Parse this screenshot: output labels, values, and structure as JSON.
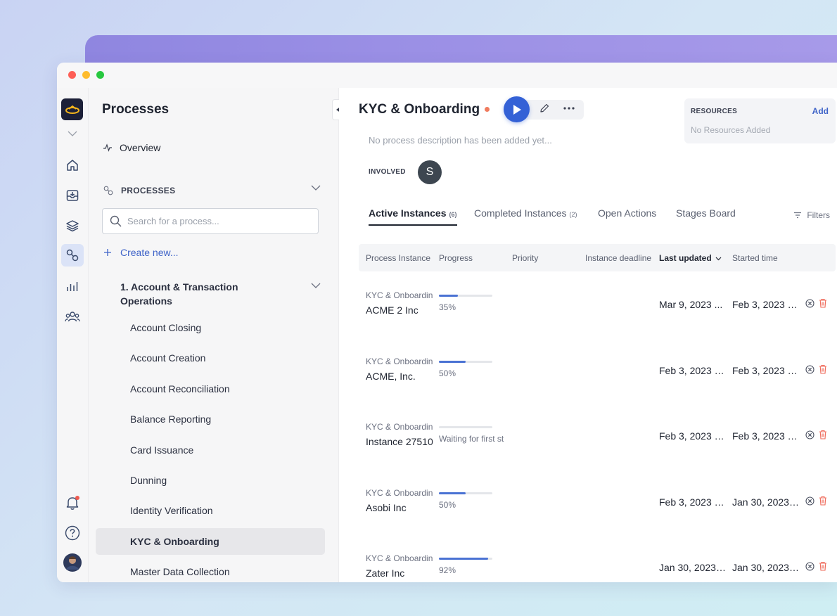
{
  "sidebar": {
    "title": "Processes",
    "overview_label": "Overview",
    "section_label": "PROCESSES",
    "search_placeholder": "Search for a process...",
    "create_label": "Create new...",
    "group_label": "1. Account & Transaction Operations",
    "items": [
      {
        "label": "Account Closing",
        "active": false
      },
      {
        "label": "Account Creation",
        "active": false
      },
      {
        "label": "Account Reconciliation",
        "active": false
      },
      {
        "label": "Balance Reporting",
        "active": false
      },
      {
        "label": "Card Issuance",
        "active": false
      },
      {
        "label": "Dunning",
        "active": false
      },
      {
        "label": "Identity Verification",
        "active": false
      },
      {
        "label": "KYC & Onboarding",
        "active": true
      },
      {
        "label": "Master Data Collection",
        "active": false
      }
    ]
  },
  "rail": {
    "icons": [
      "home-icon",
      "inbox-icon",
      "layers-icon",
      "processes-icon",
      "analytics-icon",
      "team-icon",
      "bell-icon",
      "help-icon",
      "user-avatar"
    ],
    "active": "processes-icon"
  },
  "header": {
    "title": "KYC & Onboarding",
    "description": "No process description has been added yet...",
    "involved_label": "INVOLVED",
    "involved_initial": "S"
  },
  "resources": {
    "label": "RESOURCES",
    "add_label": "Add",
    "empty_text": "No Resources Added"
  },
  "tabs": [
    {
      "label": "Active Instances",
      "count": "(6)",
      "active": true
    },
    {
      "label": "Completed Instances",
      "count": "(2)",
      "active": false
    },
    {
      "label": "Open Actions",
      "count": "",
      "active": false
    },
    {
      "label": "Stages Board",
      "count": "",
      "active": false
    }
  ],
  "filters_label": "Filters",
  "table": {
    "columns": [
      "Process Instance",
      "Progress",
      "Priority",
      "Instance deadline",
      "Last updated",
      "Started time"
    ],
    "sorted_column": "Last updated",
    "rows": [
      {
        "process": "KYC & Onboardin",
        "name": "ACME 2 Inc",
        "progress": 0.35,
        "progress_label": "35%",
        "last_updated": "Mar 9, 2023 ...",
        "started": "Feb 3, 2023 2..."
      },
      {
        "process": "KYC & Onboardin",
        "name": "ACME, Inc.",
        "progress": 0.5,
        "progress_label": "50%",
        "last_updated": "Feb 3, 2023 1...",
        "started": "Feb 3, 2023 1..."
      },
      {
        "process": "KYC & Onboardin",
        "name": "Instance 27510",
        "progress": 0,
        "progress_label": "Waiting for first st",
        "last_updated": "Feb 3, 2023 1...",
        "started": "Feb 3, 2023 1..."
      },
      {
        "process": "KYC & Onboardin",
        "name": "Asobi Inc",
        "progress": 0.5,
        "progress_label": "50%",
        "last_updated": "Feb 3, 2023 1...",
        "started": "Jan 30, 2023 ..."
      },
      {
        "process": "KYC & Onboardin",
        "name": "Zater Inc",
        "progress": 0.92,
        "progress_label": "92%",
        "last_updated": "Jan 30, 2023 ...",
        "started": "Jan 30, 2023 ..."
      }
    ]
  },
  "colors": {
    "accent": "#3461d6",
    "link": "#3e63c8",
    "status_dot": "#f07b5e",
    "delete": "#ef6a5a"
  }
}
